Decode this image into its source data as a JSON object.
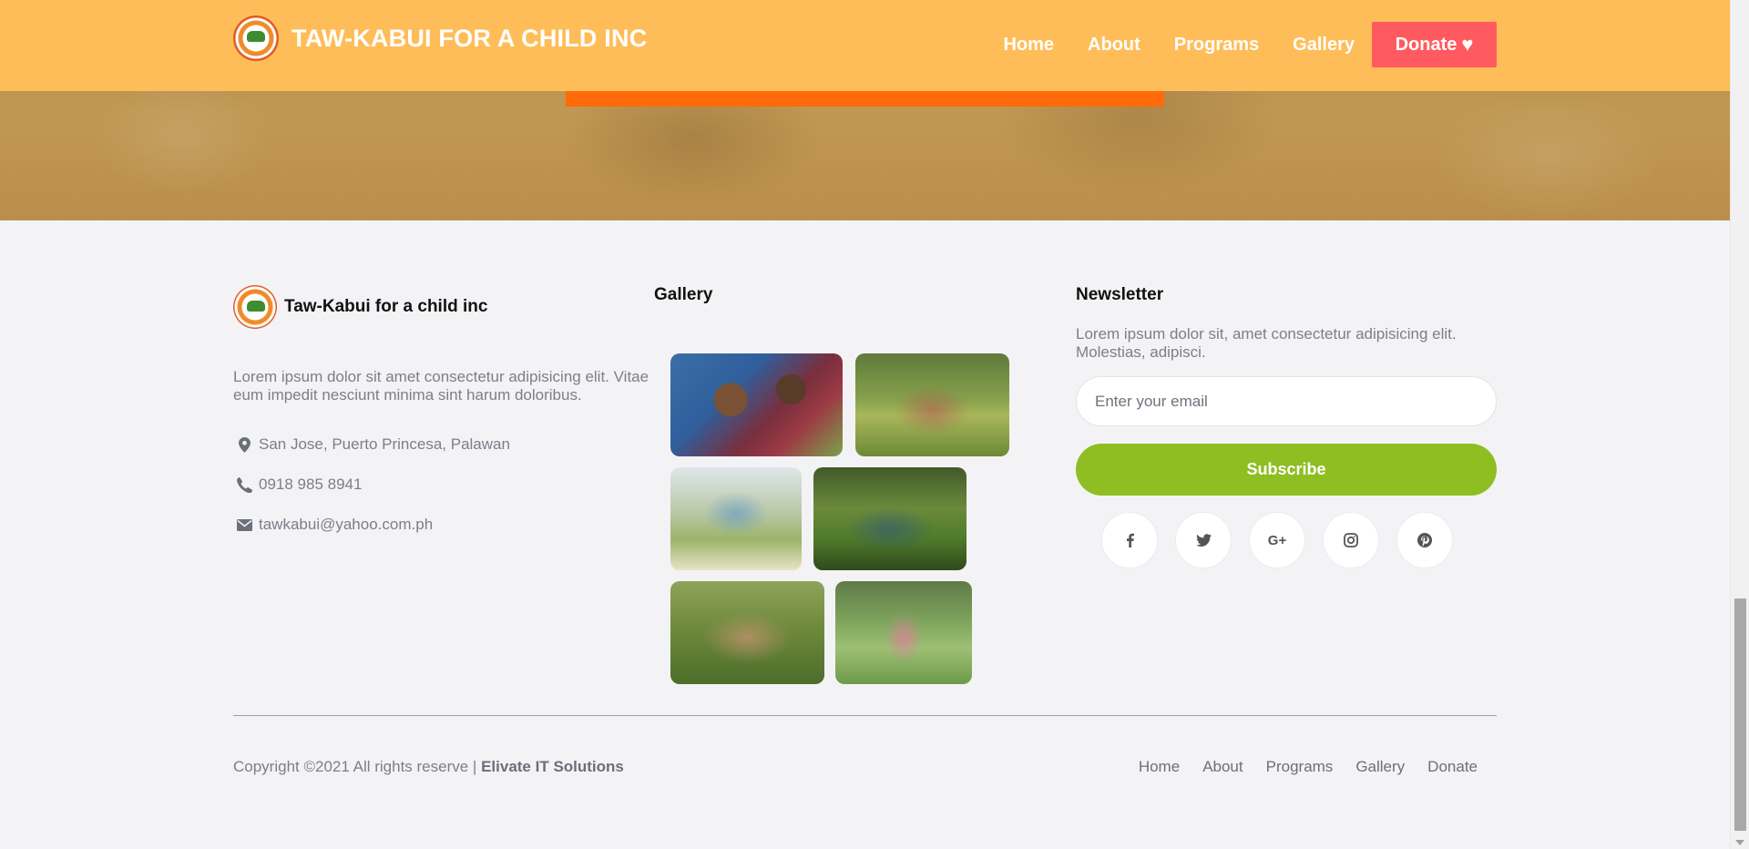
{
  "navbar": {
    "brand_title": "TAW-KABUI FOR A CHILD INC",
    "links": [
      "Home",
      "About",
      "Programs",
      "Gallery"
    ],
    "donate_label": "Donate"
  },
  "footer": {
    "about": {
      "title": "Taw-Kabui for a child inc",
      "description": "Lorem ipsum dolor sit amet consectetur adipisicing elit. Vitae eum impedit nesciunt minima sint harum doloribus.",
      "address": "San Jose, Puerto Princesa, Palawan",
      "phone": "0918 985 8941",
      "email": "tawkabui@yahoo.com.ph"
    },
    "gallery": {
      "title": "Gallery"
    },
    "newsletter": {
      "title": "Newsletter",
      "description": "Lorem ipsum dolor sit, amet consectetur adipisicing elit. Molestias, adipisci.",
      "email_placeholder": "Enter your email",
      "subscribe_label": "Subscribe",
      "socials": [
        "f",
        "t",
        "G+",
        "ig",
        "p"
      ]
    },
    "copyright": {
      "text": "Copyright ©2021 All rights reserve | ",
      "company": "Elivate IT Solutions"
    },
    "links": [
      "Home",
      "About",
      "Programs",
      "Gallery",
      "Donate"
    ]
  },
  "colors": {
    "navbar": "#ffbd59",
    "donate": "#ff5a5f",
    "accent": "#ff6a0a",
    "subscribe": "#8ebe22"
  }
}
